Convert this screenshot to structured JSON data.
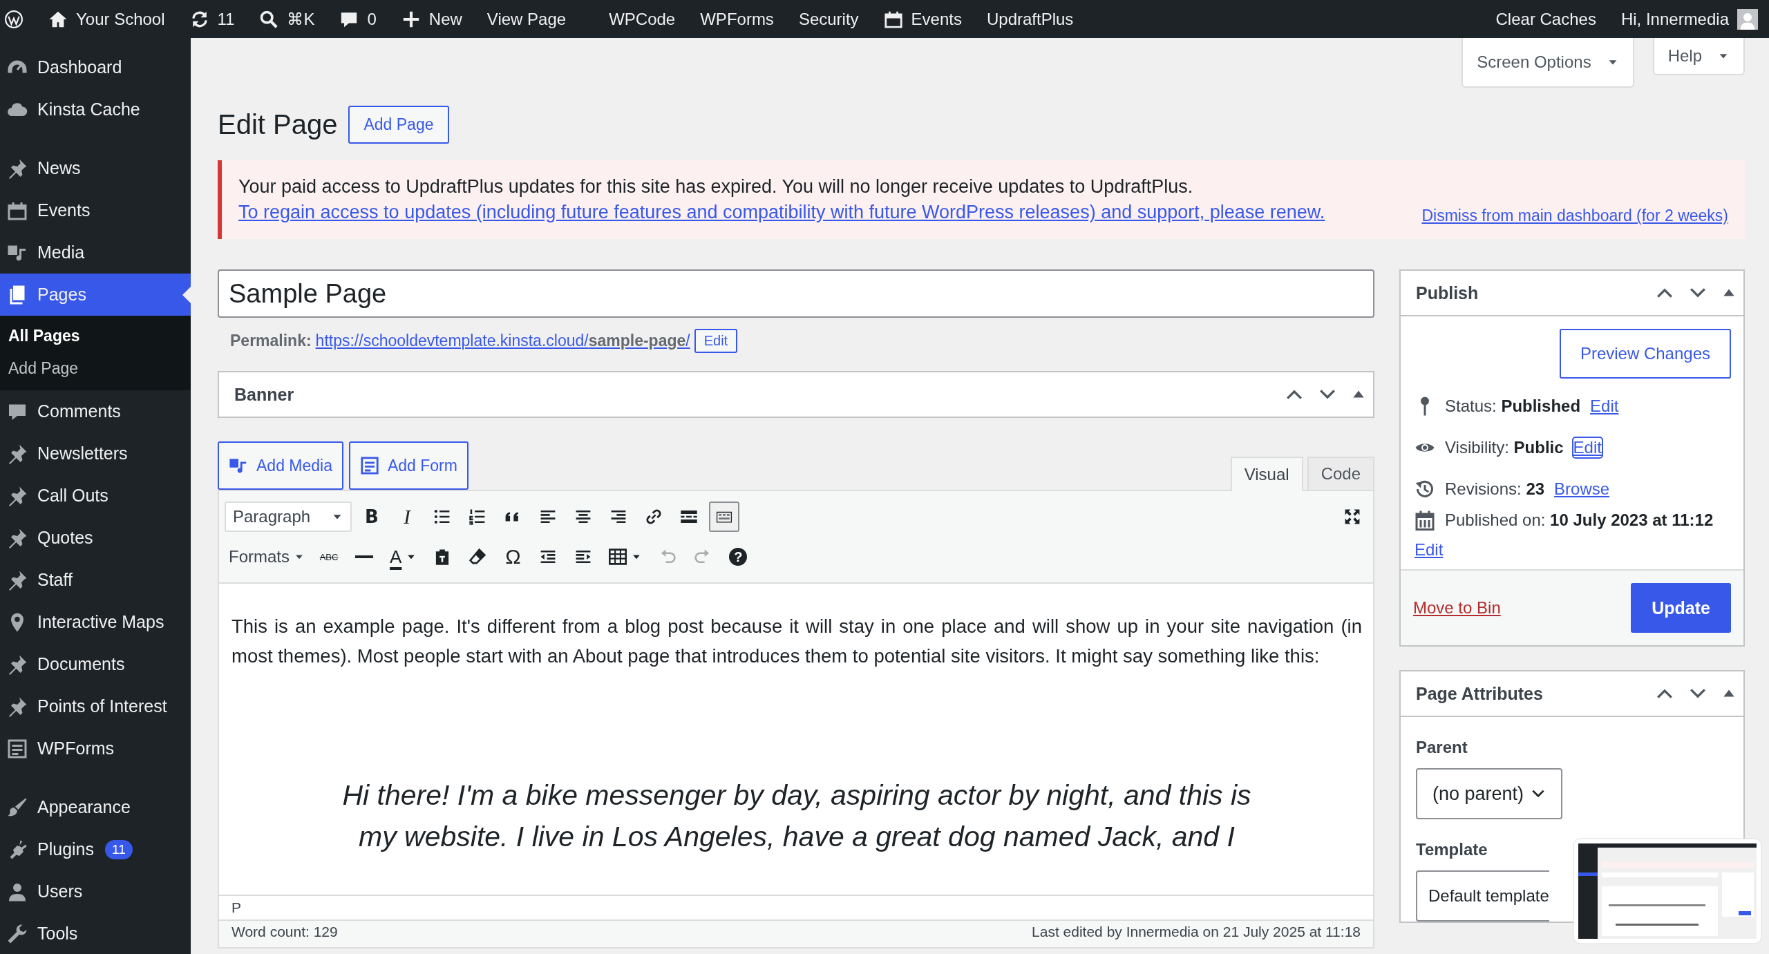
{
  "admin_bar": {
    "left": [
      {
        "kind": "logo"
      },
      {
        "kind": "home",
        "label": "Your School"
      },
      {
        "kind": "updates",
        "label": "11"
      },
      {
        "kind": "search",
        "label": "⌘K"
      },
      {
        "kind": "comments",
        "label": "0"
      },
      {
        "kind": "new",
        "label": "New"
      },
      {
        "kind": "text",
        "label": "View Page"
      }
    ],
    "plugins": [
      {
        "kind": "text",
        "label": "WPCode"
      },
      {
        "kind": "text",
        "label": "WPForms"
      },
      {
        "kind": "text",
        "label": "Security"
      },
      {
        "kind": "events",
        "label": "Events"
      },
      {
        "kind": "text",
        "label": "UpdraftPlus"
      }
    ],
    "right": [
      {
        "label": "Clear Caches"
      },
      {
        "label": "Hi, Innermedia"
      }
    ]
  },
  "sidebar": {
    "groups": [
      [
        {
          "label": "Dashboard",
          "kind": "dashboard",
          "selected": false
        },
        {
          "label": "Kinsta Cache",
          "kind": "cloud",
          "selected": false
        }
      ],
      [
        {
          "label": "News",
          "kind": "pin",
          "selected": false
        },
        {
          "label": "Events",
          "kind": "events",
          "selected": false
        },
        {
          "label": "Media",
          "kind": "media",
          "selected": false
        },
        {
          "label": "Pages",
          "kind": "pages",
          "selected": true,
          "children": [
            {
              "label": "All Pages",
              "selected": true
            },
            {
              "label": "Add Page",
              "selected": false
            }
          ]
        },
        {
          "label": "Comments",
          "kind": "comments",
          "selected": false
        },
        {
          "label": "Newsletters",
          "kind": "pin",
          "selected": false
        },
        {
          "label": "Call Outs",
          "kind": "pin",
          "selected": false
        },
        {
          "label": "Quotes",
          "kind": "pin",
          "selected": false
        },
        {
          "label": "Staff",
          "kind": "pin",
          "selected": false
        },
        {
          "label": "Interactive Maps",
          "kind": "mappin",
          "selected": false
        },
        {
          "label": "Documents",
          "kind": "pin",
          "selected": false
        },
        {
          "label": "Points of Interest",
          "kind": "pin",
          "selected": false
        },
        {
          "label": "WPForms",
          "kind": "form",
          "selected": false
        }
      ],
      [
        {
          "label": "Appearance",
          "kind": "brush",
          "selected": false
        },
        {
          "label": "Plugins",
          "kind": "plug",
          "selected": false,
          "badge": "11"
        },
        {
          "label": "Users",
          "kind": "user",
          "selected": false
        },
        {
          "label": "Tools",
          "kind": "wrench",
          "selected": false
        }
      ]
    ]
  },
  "screen_tabs": [
    "Screen Options",
    "Help"
  ],
  "page_title": "Edit Page",
  "add_button": "Add Page",
  "notice": {
    "text": "Your paid access to UpdraftPlus updates for this site has expired. You will no longer receive updates to UpdraftPlus.",
    "link": "To regain access to updates (including future features and compatibility with future WordPress releases) and support, please renew.",
    "dismiss": "Dismiss from main dashboard (for 2 weeks)"
  },
  "title_field": {
    "value": "Sample Page"
  },
  "permalink": {
    "label": "Permalink:",
    "url": "https://schooldevtemplate.kinsta.cloud/**sample-page**/",
    "button": "Edit"
  },
  "banner_box": {
    "title": "Banner"
  },
  "media_buttons": [
    {
      "kind": "media",
      "label": "Add Media"
    },
    {
      "kind": "form",
      "label": "Add Form"
    }
  ],
  "editor_tabs": [
    {
      "label": "Visual",
      "selected": true
    },
    {
      "label": "Code",
      "selected": false
    }
  ],
  "toolbar_rows": [
    [
      {
        "kind": "select",
        "label": "Paragraph",
        "disabled": false,
        "pressed": false
      },
      {
        "kind": "bold",
        "glyph": "B",
        "disabled": false,
        "pressed": false
      },
      {
        "kind": "italic",
        "glyph": "I",
        "disabled": false,
        "pressed": false
      },
      {
        "kind": "bullets",
        "disabled": false,
        "pressed": false
      },
      {
        "kind": "numbers",
        "disabled": false,
        "pressed": false
      },
      {
        "kind": "quote",
        "disabled": false,
        "pressed": false
      },
      {
        "kind": "alignleft",
        "disabled": false,
        "pressed": false
      },
      {
        "kind": "aligncenter",
        "disabled": false,
        "pressed": false
      },
      {
        "kind": "alignright",
        "disabled": false,
        "pressed": false
      },
      {
        "kind": "link",
        "disabled": false,
        "pressed": false
      },
      {
        "kind": "more",
        "disabled": false,
        "pressed": false
      },
      {
        "kind": "toggle",
        "disabled": false,
        "pressed": true
      },
      {
        "kind": "fullscreen",
        "disabled": false,
        "pressed": false
      }
    ],
    [
      {
        "kind": "menu",
        "label": "Formats",
        "disabled": false,
        "pressed": false
      },
      {
        "kind": "strike",
        "glyph": "ABC",
        "disabled": false,
        "pressed": false
      },
      {
        "kind": "hr",
        "disabled": false,
        "pressed": false
      },
      {
        "kind": "textcolor",
        "glyph": "A",
        "disabled": false,
        "pressed": false
      },
      {
        "kind": "paste",
        "disabled": false,
        "pressed": false
      },
      {
        "kind": "eraser",
        "disabled": false,
        "pressed": false
      },
      {
        "kind": "special",
        "glyph": "Ω",
        "disabled": false,
        "pressed": false
      },
      {
        "kind": "outdent",
        "disabled": false,
        "pressed": false
      },
      {
        "kind": "indent",
        "disabled": false,
        "pressed": false
      },
      {
        "kind": "table",
        "disabled": false,
        "pressed": false
      },
      {
        "kind": "undo",
        "disabled": true,
        "pressed": false
      },
      {
        "kind": "redo",
        "disabled": true,
        "pressed": false
      },
      {
        "kind": "help",
        "glyph": "?",
        "disabled": false,
        "pressed": false
      }
    ]
  ],
  "content": {
    "paragraph": "This is an example page. It's different from a blog post because it will stay in one place and will show up in your site navigation (in most themes). Most people start with an About page that introduces them to potential site visitors. It might say something like this:",
    "quote": "Hi there! I'm a bike messenger by day, aspiring actor by night, and this is my website. I live in Los Angeles, have a great dog named Jack, and I"
  },
  "path": "P",
  "word_count": "Word count: 129",
  "last_edited": "Last edited by Innermedia on 21 July 2025 at 11:18",
  "publish": {
    "title": "Publish",
    "preview": "Preview Changes",
    "rows": [
      {
        "kind": "status",
        "text": "Status: **Published**",
        "link": "Edit",
        "focused": false
      },
      {
        "kind": "visibility",
        "text": "Visibility: **Public**",
        "link": "Edit",
        "focused": true
      },
      {
        "kind": "revisions",
        "text": "Revisions: **23**",
        "link": "Browse",
        "focused": false
      },
      {
        "kind": "date",
        "text": "Published on: **10 July 2023 at 11:12**",
        "link": "Edit",
        "focused": false
      }
    ],
    "bin": "Move to Bin",
    "update": "Update"
  },
  "page_attributes": {
    "title": "Page Attributes",
    "parent_label": "Parent",
    "parent": "(no parent)",
    "template_label": "Template",
    "template": "Default template"
  },
  "thumbnail": {
    "kind": "picture"
  }
}
